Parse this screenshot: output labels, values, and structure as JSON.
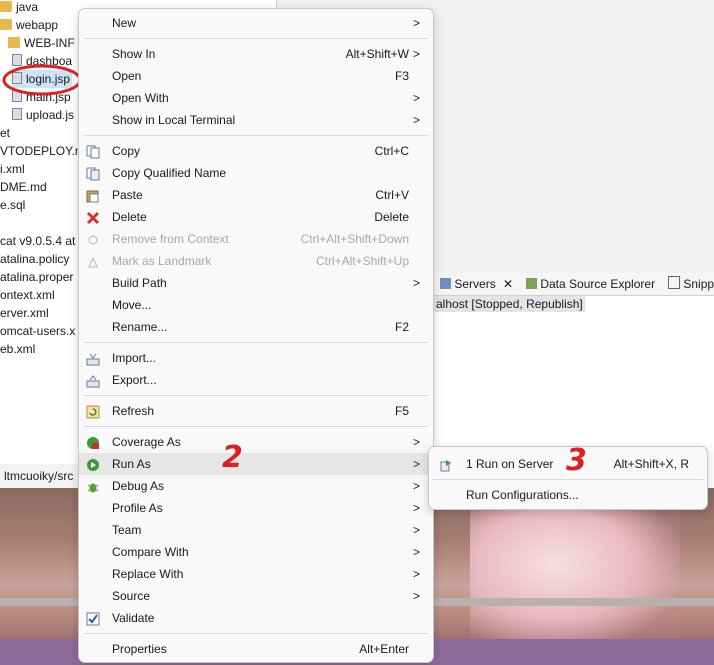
{
  "tree": {
    "items": [
      "java",
      "webapp",
      "WEB-INF",
      "dashboa",
      "login.jsp",
      "main.jsp",
      "upload.js",
      "et",
      "VTODEPLOY.r",
      "i.xml",
      "DME.md",
      "e.sql",
      "cat v9.0.5.4 at",
      "atalina.policy",
      "atalina.proper",
      "ontext.xml",
      "erver.xml",
      "omcat-users.x",
      "eb.xml"
    ]
  },
  "editor_tab_label": "ltmcuoiky/src",
  "servers": {
    "tabs": [
      "Servers",
      "Data Source Explorer",
      "Snipp"
    ],
    "row": "alhost  [Stopped, Republish]"
  },
  "menu": {
    "items": [
      {
        "label": "New",
        "accel": "",
        "arrow": ">"
      },
      {
        "label": "Show In",
        "accel": "Alt+Shift+W",
        "arrow": ">"
      },
      {
        "label": "Open",
        "accel": "F3",
        "arrow": ""
      },
      {
        "label": "Open With",
        "accel": "",
        "arrow": ">"
      },
      {
        "label": "Show in Local Terminal",
        "accel": "",
        "arrow": ">"
      },
      {
        "label": "Copy",
        "accel": "Ctrl+C",
        "arrow": ""
      },
      {
        "label": "Copy Qualified Name",
        "accel": "",
        "arrow": ""
      },
      {
        "label": "Paste",
        "accel": "Ctrl+V",
        "arrow": ""
      },
      {
        "label": "Delete",
        "accel": "Delete",
        "arrow": ""
      },
      {
        "label": "Remove from Context",
        "accel": "Ctrl+Alt+Shift+Down",
        "arrow": ""
      },
      {
        "label": "Mark as Landmark",
        "accel": "Ctrl+Alt+Shift+Up",
        "arrow": ""
      },
      {
        "label": "Build Path",
        "accel": "",
        "arrow": ">"
      },
      {
        "label": "Move...",
        "accel": "",
        "arrow": ""
      },
      {
        "label": "Rename...",
        "accel": "F2",
        "arrow": ""
      },
      {
        "label": "Import...",
        "accel": "",
        "arrow": ""
      },
      {
        "label": "Export...",
        "accel": "",
        "arrow": ""
      },
      {
        "label": "Refresh",
        "accel": "F5",
        "arrow": ""
      },
      {
        "label": "Coverage As",
        "accel": "",
        "arrow": ">"
      },
      {
        "label": "Run As",
        "accel": "",
        "arrow": ">"
      },
      {
        "label": "Debug As",
        "accel": "",
        "arrow": ">"
      },
      {
        "label": "Profile As",
        "accel": "",
        "arrow": ">"
      },
      {
        "label": "Team",
        "accel": "",
        "arrow": ">"
      },
      {
        "label": "Compare With",
        "accel": "",
        "arrow": ">"
      },
      {
        "label": "Replace With",
        "accel": "",
        "arrow": ">"
      },
      {
        "label": "Source",
        "accel": "",
        "arrow": ">"
      },
      {
        "label": "Validate",
        "accel": "",
        "arrow": ""
      },
      {
        "label": "Properties",
        "accel": "Alt+Enter",
        "arrow": ""
      }
    ]
  },
  "submenu": {
    "items": [
      {
        "label": "1 Run on Server",
        "accel": "Alt+Shift+X, R"
      },
      {
        "label": "Run Configurations...",
        "accel": ""
      }
    ]
  },
  "annotations": [
    "2",
    "3"
  ]
}
